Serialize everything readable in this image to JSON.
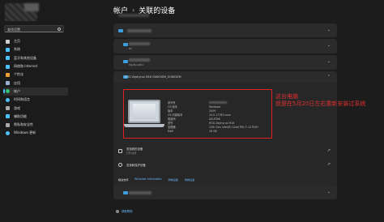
{
  "breadcrumb": {
    "parent": "帐户",
    "separator": "›",
    "current": "关联的设备"
  },
  "sidebar": {
    "search_placeholder": "查找设置",
    "items": [
      {
        "label": "主页",
        "icon": "home-icon",
        "color": "#e0e0e0"
      },
      {
        "label": "系统",
        "icon": "system-icon",
        "color": "#4cc2ff"
      },
      {
        "label": "蓝牙和其他设备",
        "icon": "bluetooth-icon",
        "color": "#4cc2ff"
      },
      {
        "label": "网络和 Internet",
        "icon": "network-icon",
        "color": "#4cc2ff"
      },
      {
        "label": "个性化",
        "icon": "personalize-icon",
        "color": "#f0a030"
      },
      {
        "label": "应用",
        "icon": "apps-icon",
        "color": "#9ab0d0"
      },
      {
        "label": "帐户",
        "icon": "accounts-icon",
        "color": "#30c070",
        "active": true
      },
      {
        "label": "时间和语言",
        "icon": "time-icon",
        "color": "#4cc2ff"
      },
      {
        "label": "游戏",
        "icon": "gaming-icon",
        "color": "#aaaaaa"
      },
      {
        "label": "辅助功能",
        "icon": "accessibility-icon",
        "color": "#4cc2ff"
      },
      {
        "label": "隐私和安全性",
        "icon": "privacy-icon",
        "color": "#aaaaaa"
      },
      {
        "label": "Windows 更新",
        "icon": "update-icon",
        "color": "#4cc2ff"
      }
    ]
  },
  "devices": [
    {
      "name_hidden": true
    },
    {
      "name_hidden": true,
      "sub": "PC"
    },
    {
      "name_hidden": true,
      "sub": "MacBookPro"
    },
    {
      "name": "ROG Zephyrus M16 GU603ZM_GU603ZM"
    }
  ],
  "specs": {
    "labels": [
      "序列号",
      "OS 版本",
      "版本",
      "OS 内部版本",
      "制造商",
      "型号",
      "处理器",
      "RAM"
    ],
    "values": [
      "",
      "Windows",
      "2009",
      "10.0.17763.xxxx",
      "ASUSTeK",
      "ROG Zephyrus M16",
      "12th Gen Intel(R) Core(TM) i7-12700H",
      "16 GB"
    ]
  },
  "annotation": {
    "line1": "这台电脑",
    "line2": "就是在5月20日左右重新安装过系统"
  },
  "actions": [
    {
      "title": "查找我的设备",
      "sub": "打开/关闭",
      "icon": "locate-icon"
    },
    {
      "title": "查找和保护设备",
      "sub": "",
      "icon": "shield-icon"
    }
  ],
  "links": {
    "first": "相关支持",
    "items": [
      "BitLocker information",
      "购物设备",
      "购物设备"
    ]
  },
  "help": "获取帮助"
}
